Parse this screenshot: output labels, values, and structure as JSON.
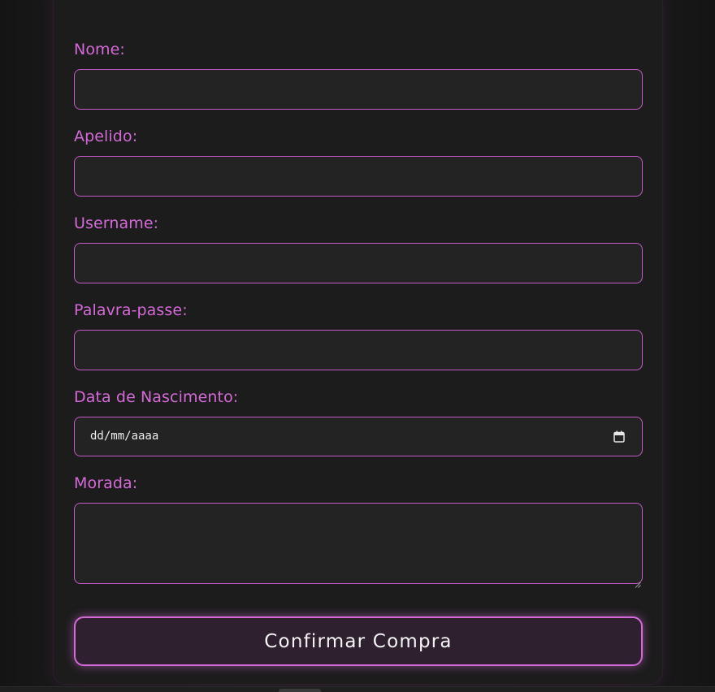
{
  "form": {
    "fields": [
      {
        "label": "Nome:",
        "value": ""
      },
      {
        "label": "Apelido:",
        "value": ""
      },
      {
        "label": "Username:",
        "value": ""
      },
      {
        "label": "Palavra-passe:",
        "value": ""
      }
    ],
    "birthdate": {
      "label": "Data de Nascimento:",
      "placeholder": "dd/mm/aaaa"
    },
    "address": {
      "label": "Morada:",
      "value": ""
    },
    "submit_label": "Confirmar Compra"
  },
  "colors": {
    "accent": "#d46ad8",
    "input_background": "#232323",
    "card_background": "#1c1c1c",
    "page_background": "#151515",
    "button_background": "#2f2030"
  },
  "icons": {
    "date_picker": "calendar-icon",
    "textarea_resize": "resize-grip-icon"
  }
}
